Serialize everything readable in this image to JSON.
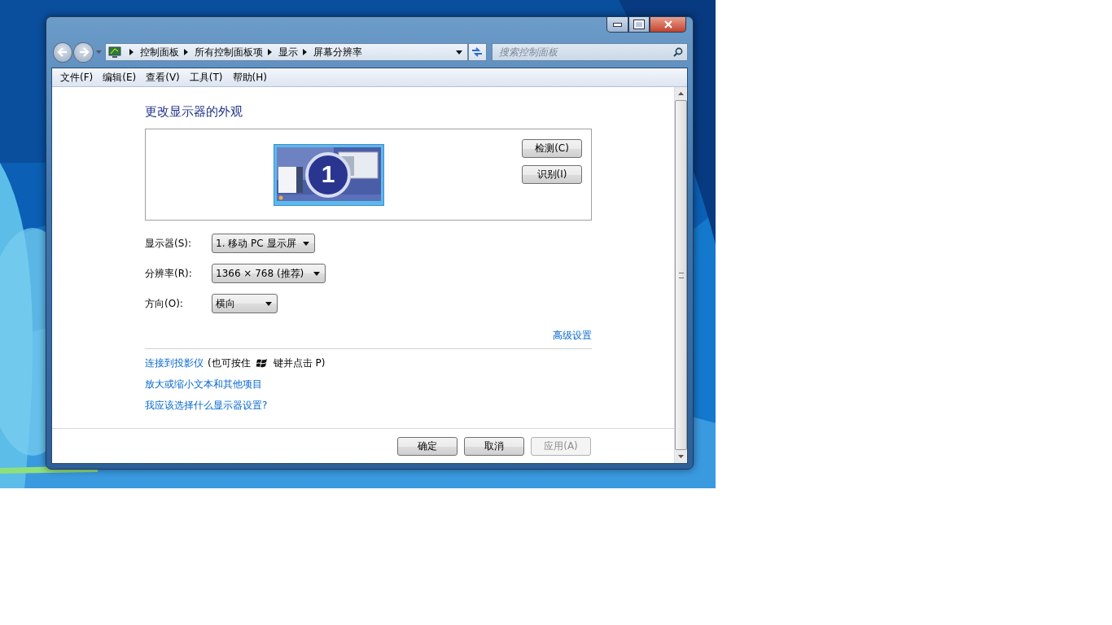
{
  "address_bar": {
    "crumbs": [
      "控制面板",
      "所有控制面板项",
      "显示",
      "屏幕分辨率"
    ]
  },
  "search": {
    "placeholder": "搜索控制面板"
  },
  "menu": [
    "文件(F)",
    "编辑(E)",
    "查看(V)",
    "工具(T)",
    "帮助(H)"
  ],
  "heading": "更改显示器的外观",
  "monitor_number": "1",
  "side_buttons": [
    "检测(C)",
    "识别(I)"
  ],
  "fields": [
    {
      "label": "显示器(S):",
      "value": "1. 移动 PC 显示屏"
    },
    {
      "label": "分辨率(R):",
      "value": "1366 × 768 (推荐)"
    },
    {
      "label": "方向(O):",
      "value": "横向"
    }
  ],
  "advanced_link": "高级设置",
  "links": [
    {
      "kind": "projector",
      "link": "连接到投影仪",
      "before": "(也可按住",
      "after": "键并点击 P)"
    },
    {
      "kind": "plain",
      "link": "放大或缩小文本和其他项目"
    },
    {
      "kind": "plain",
      "link": "我应该选择什么显示器设置?"
    }
  ],
  "buttons": [
    {
      "label": "确定",
      "disabled": false
    },
    {
      "label": "取消",
      "disabled": false
    },
    {
      "label": "应用(A)",
      "disabled": true
    }
  ]
}
